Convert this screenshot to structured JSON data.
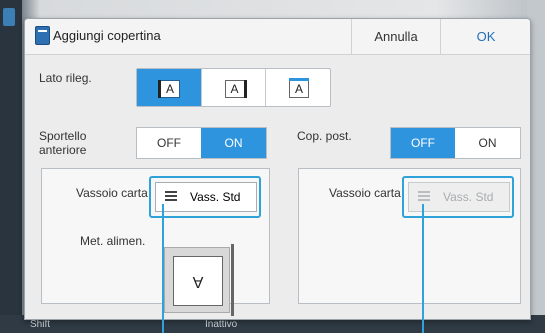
{
  "dialog": {
    "title": "Aggiungi copertina",
    "cancel_label": "Annulla",
    "ok_label": "OK"
  },
  "binding": {
    "label": "Lato rileg.",
    "options": [
      {
        "letter": "A",
        "side": "left",
        "selected": true
      },
      {
        "letter": "A",
        "side": "right",
        "selected": false
      },
      {
        "letter": "A",
        "side": "top",
        "selected": false
      }
    ]
  },
  "front_cover": {
    "label": "Sportello anteriore",
    "off_label": "OFF",
    "on_label": "ON",
    "value": "ON",
    "tray_label": "Vassoio carta",
    "tray_value": "Vass. Std",
    "feed_label": "Met. alimen.",
    "feed_paper_letter": "A"
  },
  "back_cover": {
    "label": "Cop. post.",
    "off_label": "OFF",
    "on_label": "ON",
    "value": "OFF",
    "tray_label": "Vassoio carta",
    "tray_value": "Vass. Std"
  },
  "background": {
    "left_text": "Shift",
    "middle_text": "Inattivo"
  },
  "colors": {
    "accent": "#2f94de",
    "callout": "#2fa3d8"
  }
}
